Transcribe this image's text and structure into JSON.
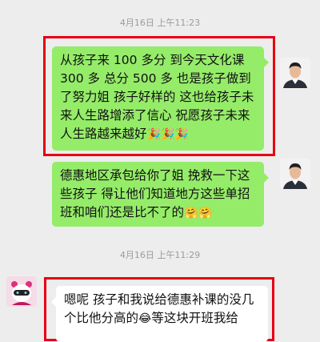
{
  "timestamps": [
    "4月16日 上午11:23",
    "4月16日 上午11:29"
  ],
  "messages": [
    {
      "side": "right",
      "text": "从孩子来 100 多分 到今天文化课 300 多 总分 500 多 也是孩子做到了努力姐 孩子好样的 这也给孩子未来人生路增添了信心 祝愿孩子未来人生路越来越好",
      "emoji_suffix": [
        "party-popper",
        "party-popper",
        "party-popper"
      ]
    },
    {
      "side": "right",
      "text": "德惠地区承包给你了姐 挽救一下这些孩子 得让他们知道地方这些单招班和咱们还是比不了的",
      "emoji_suffix": [
        "hugging-face",
        "hugging-face"
      ]
    },
    {
      "side": "left",
      "text_before": "嗯呢 孩子和我说给德惠补课的没几个比他分高的",
      "emoji_mid": "laughing-face",
      "text_after": "等这块开班我给"
    }
  ],
  "colors": {
    "background": "#ededed",
    "outgoing_bubble": "#95ec69",
    "incoming_bubble": "#ffffff",
    "highlight": "#e60012"
  }
}
